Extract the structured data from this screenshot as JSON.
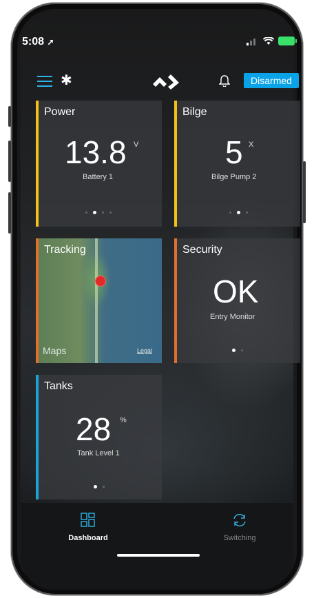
{
  "status_bar": {
    "time": "5:08"
  },
  "header": {
    "mode_badge": "Disarmed"
  },
  "tiles": {
    "power": {
      "title": "Power",
      "value": "13.8",
      "unit": "V",
      "subtitle": "Battery 1",
      "color": "#f2c21b"
    },
    "bilge": {
      "title": "Bilge",
      "value": "5",
      "unit": "X",
      "subtitle": "Bilge Pump 2",
      "color": "#f2c21b"
    },
    "tracking": {
      "title": "Tracking",
      "map_label": "Maps",
      "legal": "Legal",
      "color": "#e0702a"
    },
    "security": {
      "title": "Security",
      "value": "OK",
      "subtitle": "Entry Monitor",
      "color": "#e0702a"
    },
    "tanks": {
      "title": "Tanks",
      "value": "28",
      "unit": "%",
      "subtitle": "Tank Level 1",
      "color": "#19a4d8"
    }
  },
  "tabbar": {
    "dashboard": "Dashboard",
    "switching": "Switching",
    "active_color": "#2fb3e8"
  }
}
